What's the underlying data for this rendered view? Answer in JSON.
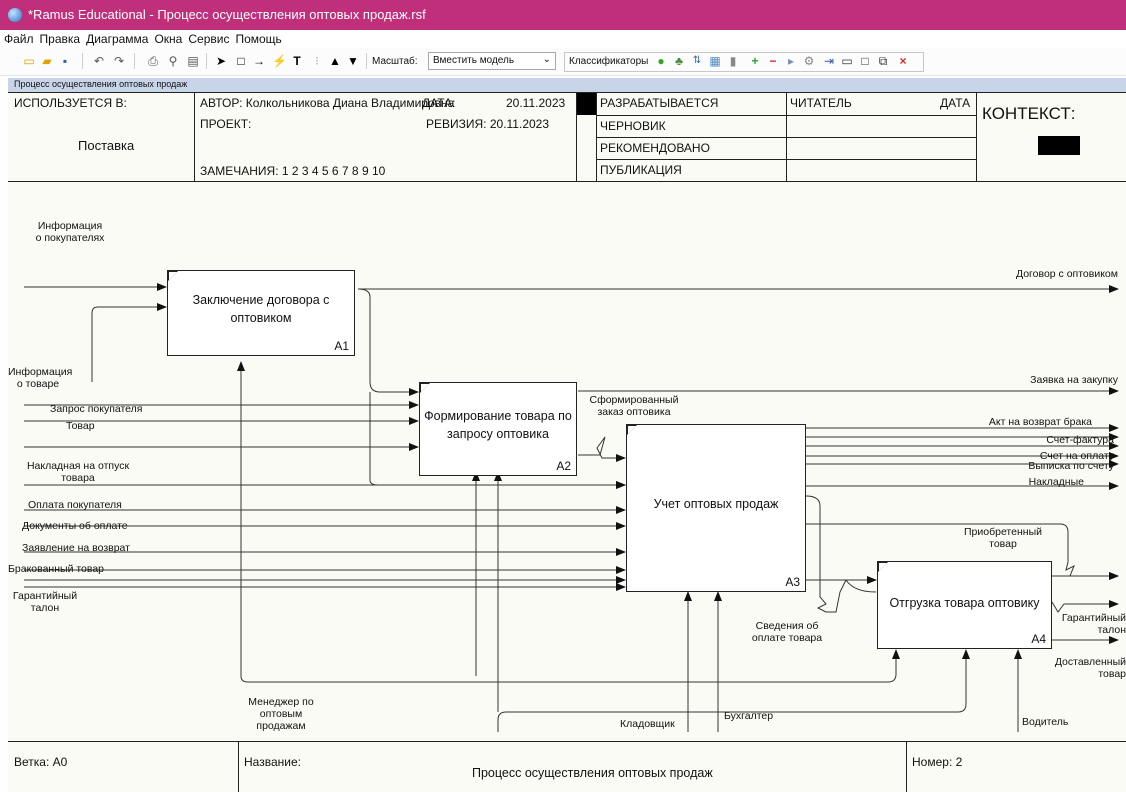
{
  "app": {
    "title": "*Ramus Educational - Процесс осуществления оптовых продаж.rsf"
  },
  "menu": [
    "Файл",
    "Правка",
    "Диаграмма",
    "Окна",
    "Сервис",
    "Помощь"
  ],
  "toolbar": {
    "zoom_label": "Масштаб:",
    "zoom_value": "Вместить модель",
    "classifiers_label": "Классификаторы"
  },
  "tab": {
    "label": "Процесс осуществления оптовых продаж"
  },
  "header": {
    "used_in_label": "ИСПОЛЬЗУЕТСЯ В:",
    "used_in_value": "Поставка",
    "author": "АВТОР: Колкольникова Диана Владимировна",
    "date_label": "ДАТА:",
    "date_value": "20.11.2023",
    "project": "ПРОЕКТ:",
    "revision": "РЕВИЗИЯ: 20.11.2023",
    "remarks": "ЗАМЕЧАНИЯ: 1 2 3 4 5 6 7 8 9 10",
    "status_working": "РАЗРАБАТЫВАЕТСЯ",
    "status_draft": "ЧЕРНОВИК",
    "status_recommended": "РЕКОМЕНДОВАНО",
    "status_publication": "ПУБЛИКАЦИЯ",
    "reader": "ЧИТАТЕЛЬ",
    "reader_date": "ДАТА",
    "context": "КОНТЕКСТ:"
  },
  "boxes": {
    "a1": {
      "name": "Заключение договора с оптовиком",
      "num": "A1"
    },
    "a2": {
      "name": "Формирование товара по запросу оптовика",
      "num": "A2"
    },
    "a3": {
      "name": "Учет оптовых продаж",
      "num": "A3"
    },
    "a4": {
      "name": "Отгрузка товара оптовику",
      "num": "A4"
    }
  },
  "arrows": {
    "info_buyers": "Информация о покупателях",
    "info_goods": "Информация о товаре",
    "request_buyer": "Запрос покупателя",
    "goods": "Товар",
    "waybill": "Накладная на отпуск товара",
    "payment_buyer": "Оплата покупателя",
    "payment_docs": "Документы об оплате",
    "return_request": "Заявление на возврат",
    "defective": "Бракованный товар",
    "warranty": "Гарантийный талон",
    "contract": "Договор с оптовиком",
    "purchase_request": "Заявка на закупку",
    "formed_order": "Сформированный заказ оптовика",
    "defect_return_act": "Акт на возврат брака",
    "invoice": "Счет-фактура",
    "bill": "Счет на оплату",
    "statement": "Выписка по счету",
    "waybills": "Накладные",
    "purchased_goods": "Приобретенный товар",
    "payment_info": "Сведения об оплате товара",
    "warranty_out": "Гарантийный талон",
    "delivered": "Доставленный товар",
    "manager": "Менеджер по оптовым продажам",
    "storekeeper": "Кладовщик",
    "accountant": "Бухгалтер",
    "driver": "Водитель"
  },
  "footer": {
    "node_label": "Ветка: А0",
    "name_label": "Название:",
    "name_value": "Процесс осуществления оптовых продаж",
    "number_label": "Номер: 2"
  },
  "colors": {
    "titlebar": "#c0307a",
    "tab": "#c8d4e8",
    "canvas": "#fbfbf6"
  }
}
